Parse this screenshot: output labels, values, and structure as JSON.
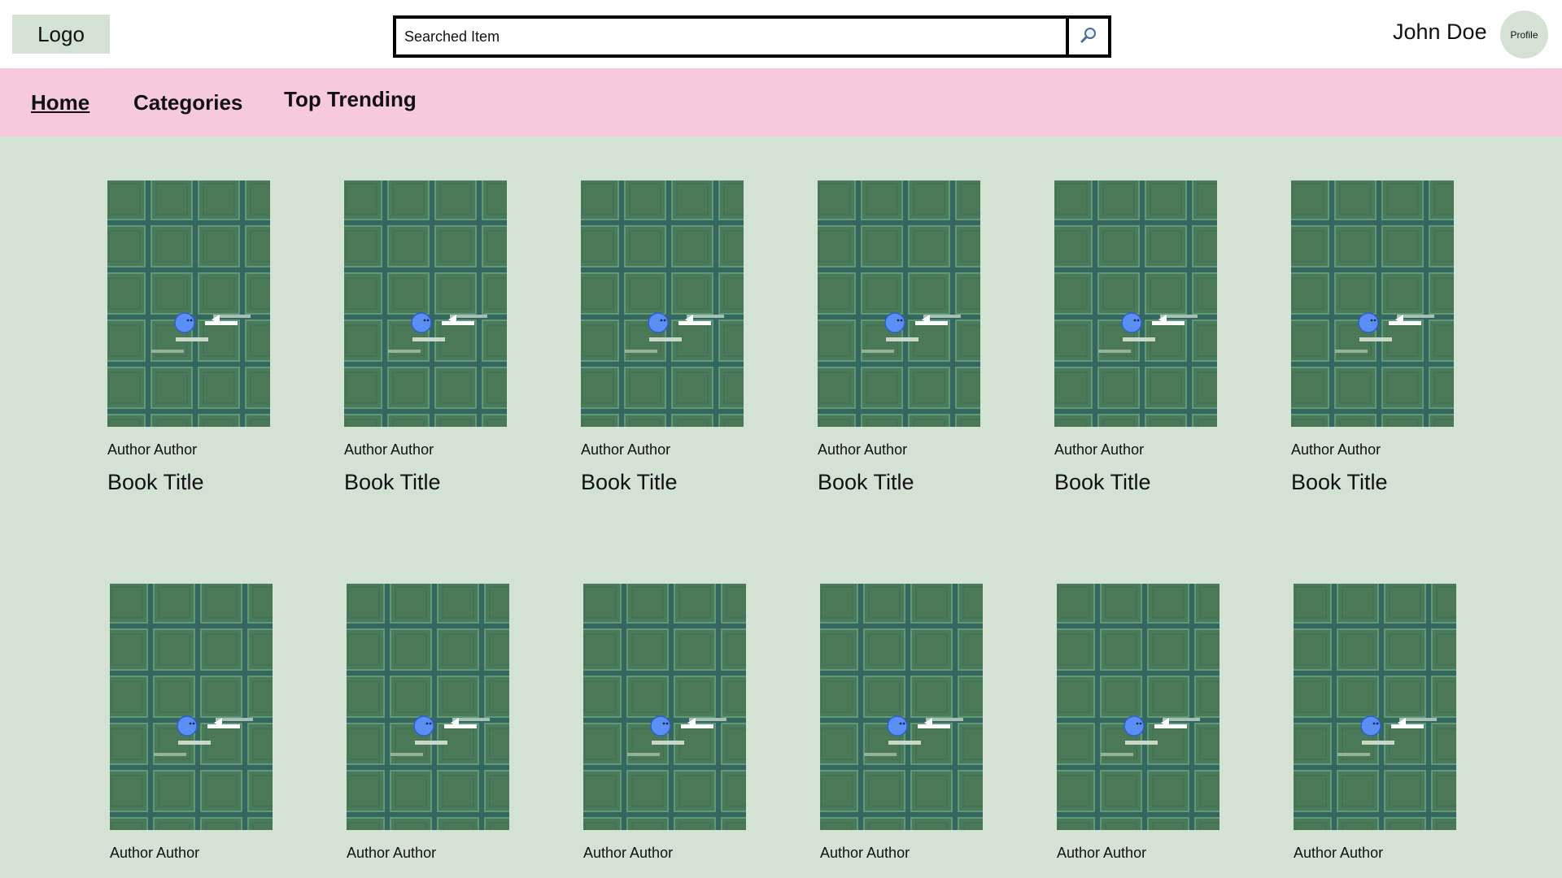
{
  "header": {
    "logo_label": "Logo",
    "search": {
      "value": "Searched Item",
      "placeholder": "Searched Item",
      "button_icon": "search-icon"
    },
    "user_name": "John Doe",
    "profile_label": "Profile"
  },
  "nav": {
    "items": [
      {
        "label": "Home",
        "active": true
      },
      {
        "label": "Categories",
        "active": false
      },
      {
        "label": "Top Trending",
        "active": false
      }
    ]
  },
  "books": {
    "row1": [
      {
        "author": "Author Author",
        "title": "Book Title"
      },
      {
        "author": "Author Author",
        "title": "Book Title"
      },
      {
        "author": "Author Author",
        "title": "Book Title"
      },
      {
        "author": "Author Author",
        "title": "Book Title"
      },
      {
        "author": "Author Author",
        "title": "Book Title"
      },
      {
        "author": "Author Author",
        "title": "Book Title"
      }
    ],
    "row2": [
      {
        "author": "Author Author"
      },
      {
        "author": "Author Author"
      },
      {
        "author": "Author Author"
      },
      {
        "author": "Author Author"
      },
      {
        "author": "Author Author"
      },
      {
        "author": "Author Author"
      }
    ]
  },
  "colors": {
    "page_bg": "#d4e2d4",
    "nav_bg": "#f7c9dd",
    "cover_bg": "#35665f",
    "cover_tile": "#4a7a58"
  }
}
